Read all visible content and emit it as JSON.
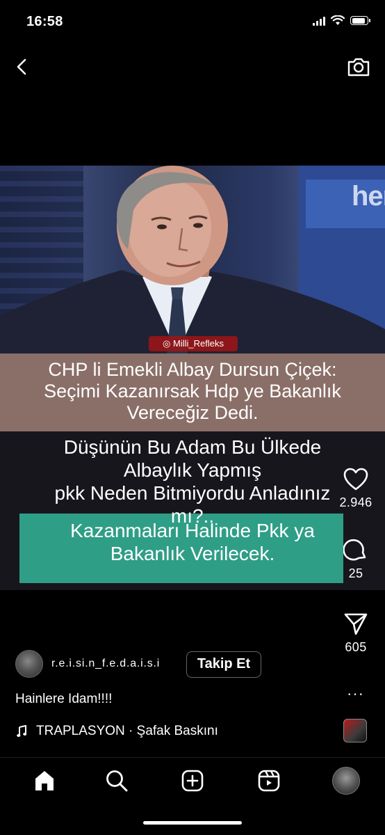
{
  "status_bar": {
    "time": "16:58",
    "battery_level": 0.9
  },
  "video": {
    "watermark": "Milli_Refleks",
    "studio_logo": "her",
    "caption_lines_1": [
      "CHP li Emekli Albay Dursun Çiçek:",
      "Seçimi Kazanırsak Hdp ye Bakanlık",
      "Vereceğiz Dedi."
    ],
    "caption_lines_2": [
      "Düşünün Bu Adam Bu Ülkede",
      "Albaylık Yapmış",
      "pkk Neden Bitmiyordu Anladınız",
      "mı?.."
    ],
    "caption_lines_3": [
      "Kazanmaları Halinde Pkk ya",
      "Bakanlık Verilecek."
    ],
    "colors": {
      "band": "#8a6f68",
      "green": "#2f9e86"
    }
  },
  "actions": {
    "likes": "2.946",
    "comments": "25",
    "shares": "605"
  },
  "post": {
    "username": "r.e.i.si.n_f.e.d.a.i.s.i",
    "follow_label": "Takip Et",
    "caption": "Hainlere Idam!!!!",
    "music": "TRAPLASYON · Şafak Baskını",
    "more": "···"
  },
  "icons": [
    "back-icon",
    "camera-icon",
    "heart-icon",
    "comment-icon",
    "share-icon",
    "more-icon",
    "music-note-icon",
    "home-icon",
    "search-icon",
    "create-icon",
    "reels-icon"
  ]
}
